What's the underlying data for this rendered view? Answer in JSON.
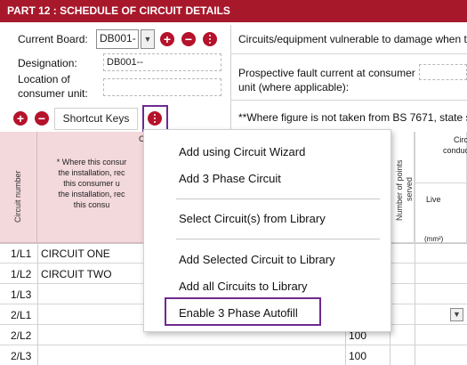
{
  "header": {
    "title": "PART 12 : SCHEDULE OF CIRCUIT DETAILS"
  },
  "board": {
    "current_board_label": "Current Board:",
    "current_board_value": "DB001-",
    "designation_label": "Designation:",
    "designation_value": "DB001--",
    "location_label_1": "Location of",
    "location_label_2": "consumer unit:",
    "location_value": ""
  },
  "right_panel": {
    "vulnerable_text": "Circuits/equipment vulnerable to damage when t",
    "pfc_label_1": "Prospective fault current at consumer",
    "pfc_label_2": "unit (where applicable):",
    "bs_note": "**Where figure is not taken from BS 7671, state s"
  },
  "toolbar": {
    "shortcut_keys_label": "Shortcut Keys"
  },
  "table": {
    "circuit_number_header": "Circuit number",
    "description_header_fragment": "C",
    "note_lines": [
      "* Where this consur",
      "the installation, rec",
      "this consumer u",
      "the installation, rec",
      "this consu"
    ],
    "points_served_header_1": "Number of points",
    "points_served_header_2": "served",
    "conductor_header_1": "Circ",
    "conductor_header_2": "conduc",
    "live_label": "Live",
    "unit_label": "(mm²)",
    "rows": [
      {
        "num": "1/L1",
        "desc": "CIRCUIT ONE",
        "value": ""
      },
      {
        "num": "1/L2",
        "desc": "CIRCUIT TWO",
        "value": ""
      },
      {
        "num": "1/L3",
        "desc": "",
        "value": ""
      },
      {
        "num": "2/L1",
        "desc": "",
        "value": ""
      },
      {
        "num": "2/L2",
        "desc": "",
        "value": "100"
      },
      {
        "num": "2/L3",
        "desc": "",
        "value": "100"
      }
    ]
  },
  "context_menu": {
    "items": [
      "Add using Circuit Wizard",
      "Add 3 Phase Circuit",
      "Select Circuit(s) from Library",
      "Add Selected Circuit to Library",
      "Add all Circuits to Library",
      "Enable 3 Phase Autofill"
    ]
  },
  "colors": {
    "brand": "#a8182b",
    "highlight": "#6e2a8f",
    "header_bg": "#f3d8dc"
  }
}
